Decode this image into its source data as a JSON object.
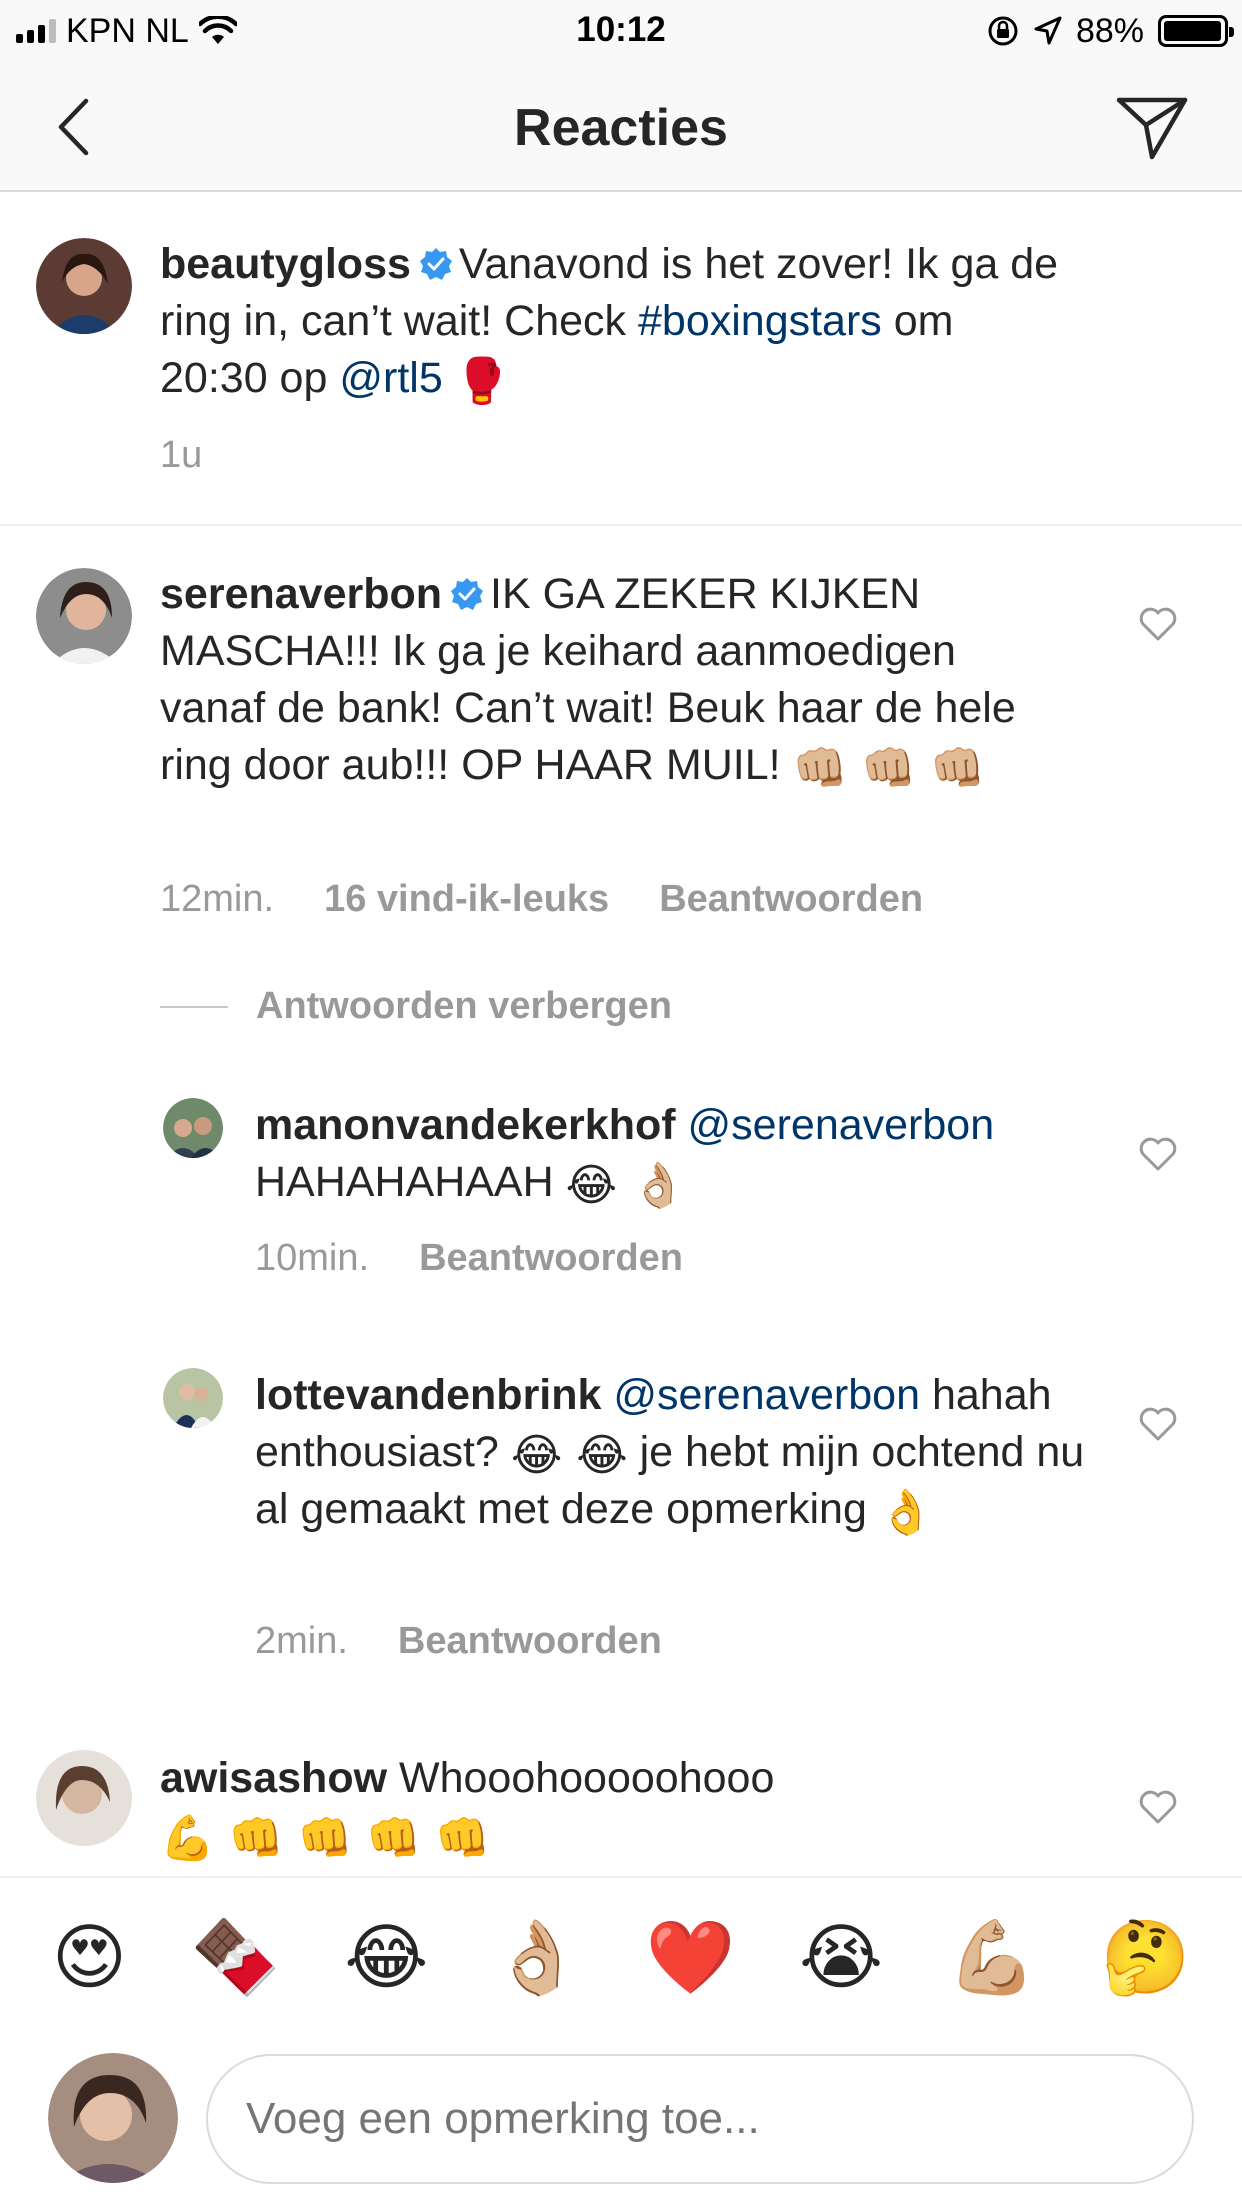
{
  "status_bar": {
    "carrier": "KPN NL",
    "time": "10:12",
    "battery": "88%",
    "battery_level": 0.88
  },
  "nav": {
    "title": "Reacties"
  },
  "caption": {
    "username": "beautygloss",
    "verified": true,
    "text_before_hashtag": "Vanavond is het zover! Ik ga de ring in, can’t wait! Check",
    "hashtag": "#boxingstars",
    "text_middle": "om 20:30 op",
    "mention": "@rtl5",
    "emoji": "🥊",
    "time": "1u"
  },
  "comments": [
    {
      "username": "serenaverbon",
      "verified": true,
      "text": "IK GA ZEKER KIJKEN MASCHA!!! Ik ga je keihard aanmoedigen vanaf de bank! Can’t wait! Beuk haar de hele ring door aub!!! OP HAAR MUIL!",
      "emojis": "👊🏼 👊🏼 👊🏼",
      "time": "12min.",
      "likes": "16 vind-ik-leuks",
      "reply_label": "Beantwoorden",
      "hide_replies_label": "Antwoorden verbergen",
      "replies": [
        {
          "username": "manonvandekerkhof",
          "mention": "@serenaverbon",
          "text": "HAHAHAHAAH",
          "emojis": "😂 👌🏼",
          "time": "10min.",
          "reply_label": "Beantwoorden"
        },
        {
          "username": "lottevandenbrink",
          "mention": "@serenaverbon",
          "text_1": "hahah enthousiast?",
          "emojis_1": "😂 😂",
          "text_2": "je hebt mijn ochtend nu al gemaakt met deze opmerking",
          "emojis_2": "👌",
          "time": "2min.",
          "reply_label": "Beantwoorden"
        }
      ]
    },
    {
      "username": "awisashow",
      "verified": false,
      "text": "Whooohooooohooo",
      "emojis": "💪 👊 👊 👊 👊"
    }
  ],
  "emoji_bar": [
    "😍",
    "🍫",
    "😂",
    "👌🏼",
    "❤️",
    "😭",
    "💪🏼",
    "🤔"
  ],
  "composer": {
    "placeholder": "Voeg een opmerking toe..."
  },
  "colors": {
    "link": "#003569",
    "secondary_text": "#999999",
    "verified_blue": "#3897f0",
    "bar_background": "#f9f9f9"
  },
  "icons": [
    "signal-icon",
    "wifi-icon",
    "lock-rotation-icon",
    "location-icon",
    "battery-icon",
    "back-chevron-icon",
    "send-direct-icon",
    "verified-badge-icon",
    "heart-icon"
  ]
}
